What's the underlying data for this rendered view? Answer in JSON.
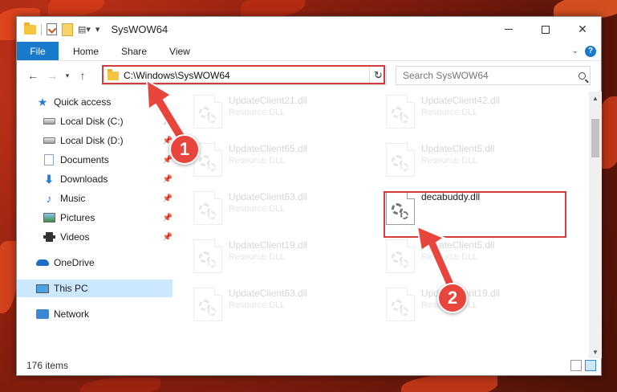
{
  "window": {
    "title": "SysWOW64"
  },
  "ribbon": {
    "tabs": [
      "File",
      "Home",
      "Share",
      "View"
    ]
  },
  "address": {
    "path": "C:\\Windows\\SysWOW64"
  },
  "search": {
    "placeholder": "Search SysWOW64"
  },
  "nav": {
    "quick_access": "Quick access",
    "items": [
      {
        "label": "Local Disk (C:)",
        "icon": "drive-icon",
        "pinned": true
      },
      {
        "label": "Local Disk (D:)",
        "icon": "drive-icon",
        "pinned": true
      },
      {
        "label": "Documents",
        "icon": "documents-icon",
        "pinned": true
      },
      {
        "label": "Downloads",
        "icon": "downloads-icon",
        "pinned": true
      },
      {
        "label": "Music",
        "icon": "music-icon",
        "pinned": true
      },
      {
        "label": "Pictures",
        "icon": "pictures-icon",
        "pinned": true
      },
      {
        "label": "Videos",
        "icon": "videos-icon",
        "pinned": true
      }
    ],
    "onedrive": "OneDrive",
    "this_pc": "This PC",
    "network": "Network"
  },
  "files": [
    {
      "name": "UpdateClient21.dll",
      "type": "Resource DLL",
      "faded": true
    },
    {
      "name": "UpdateClient42.dll",
      "type": "Resource DLL",
      "faded": true
    },
    {
      "name": "UpdateClient65.dll",
      "type": "Resource DLL",
      "faded": true
    },
    {
      "name": "UpdateClient5.dll",
      "type": "Resource DLL",
      "faded": true
    },
    {
      "name": "UpdateClient63.dll",
      "type": "Resource DLL",
      "faded": true
    },
    {
      "name": "decabuddy.dll",
      "type": "",
      "faded": false
    },
    {
      "name": "UpdateClient19.dll",
      "type": "Resource DLL",
      "faded": true
    },
    {
      "name": "UpdateClient5.dll",
      "type": "Resource DLL",
      "faded": true
    },
    {
      "name": "UpdateClient63.dll",
      "type": "Resource DLL",
      "faded": true
    },
    {
      "name": "UpdateClient19.dll",
      "type": "Resource DLL",
      "faded": true
    }
  ],
  "status": {
    "count": "176 items"
  },
  "callouts": {
    "one": "1",
    "two": "2"
  },
  "colors": {
    "accent": "#1979ca",
    "callout": "#e8453c",
    "highlight": "#d33c3c"
  }
}
